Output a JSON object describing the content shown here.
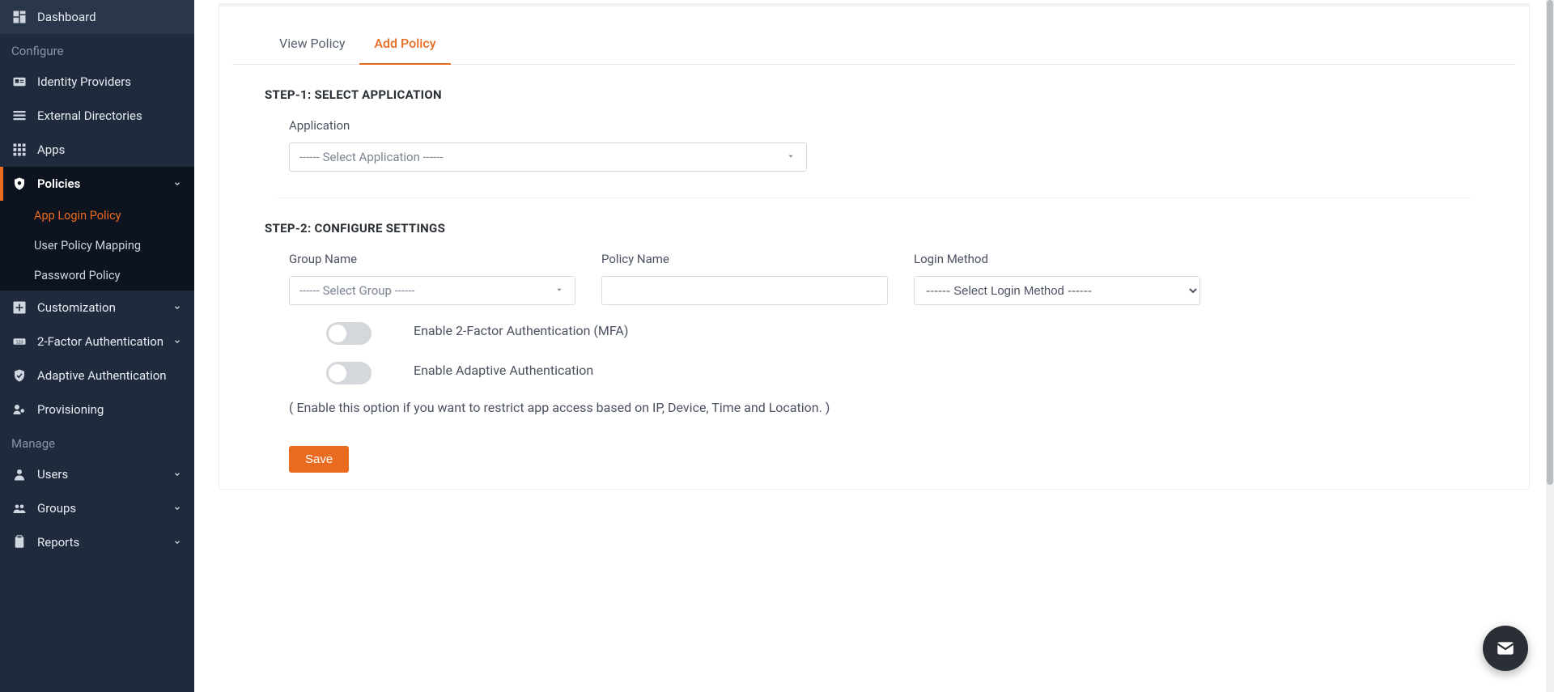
{
  "sidebar": {
    "items": [
      {
        "label": "Dashboard"
      },
      {
        "label": "Identity Providers"
      },
      {
        "label": "External Directories"
      },
      {
        "label": "Apps"
      },
      {
        "label": "Policies"
      },
      {
        "label": "Customization"
      },
      {
        "label": "2-Factor Authentication"
      },
      {
        "label": "Adaptive Authentication"
      },
      {
        "label": "Provisioning"
      },
      {
        "label": "Users"
      },
      {
        "label": "Groups"
      },
      {
        "label": "Reports"
      }
    ],
    "section_configure": "Configure",
    "section_manage": "Manage",
    "sub_policies": [
      {
        "label": "App Login Policy"
      },
      {
        "label": "User Policy Mapping"
      },
      {
        "label": "Password Policy"
      }
    ]
  },
  "tabs": {
    "view": "View Policy",
    "add": "Add Policy"
  },
  "step1": {
    "title": "STEP-1: SELECT APPLICATION",
    "app_label": "Application",
    "app_placeholder": "------ Select Application ------"
  },
  "step2": {
    "title": "STEP-2: CONFIGURE SETTINGS",
    "group_label": "Group Name",
    "group_placeholder": "------ Select Group ------",
    "policy_label": "Policy Name",
    "policy_value": "",
    "login_label": "Login Method",
    "login_placeholder": "------ Select Login Method ------",
    "toggle_mfa": "Enable 2-Factor Authentication (MFA)",
    "toggle_adaptive": "Enable Adaptive Authentication",
    "adaptive_note": "( Enable this option if you want to restrict app access based on IP, Device, Time and Location. )"
  },
  "actions": {
    "save": "Save"
  }
}
